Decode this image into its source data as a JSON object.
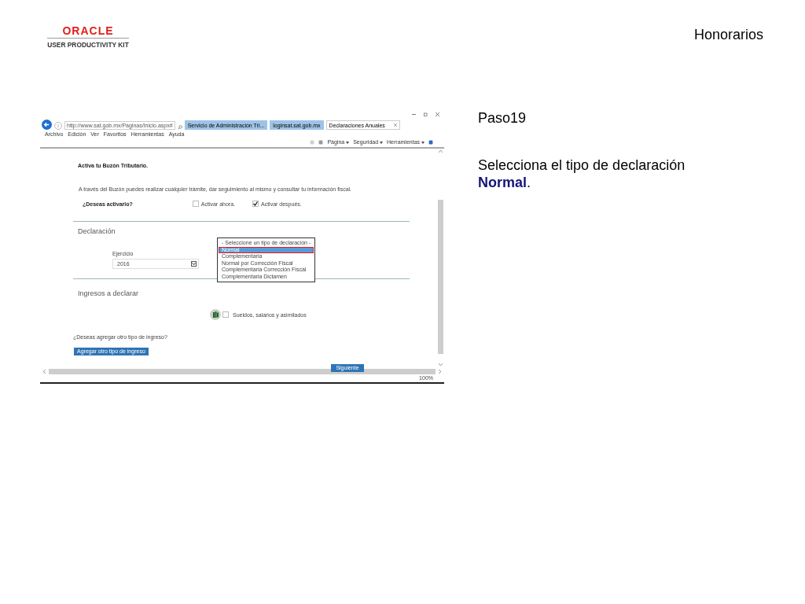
{
  "header": {
    "logo": {
      "brand": "ORACLE",
      "product": "USER PRODUCTIVITY KIT"
    },
    "title": "Honorarios"
  },
  "browser": {
    "address": "http://www.sat.gob.mx/Paginas/Inicio.aspx#",
    "tabs": [
      {
        "label": "Servicio de Administración Tri...",
        "selected": false
      },
      {
        "label": "loginsat.sat.gob.mx",
        "selected": false
      },
      {
        "label": "Declaraciones Anuales",
        "selected": true
      }
    ],
    "menu": [
      "Archivo",
      "Edición",
      "Ver",
      "Favoritos",
      "Herramientas",
      "Ayuda"
    ],
    "commands": [
      "Página",
      "Seguridad",
      "Herramientas"
    ],
    "zoom": "100%"
  },
  "page": {
    "buzon_title": "Activa tu Buzón Tributario.",
    "buzon_text": "A través del Buzón puedes realizar cualquier trámite, dar seguimiento al mismo y consultar tu información fiscal.",
    "question": "¿Deseas activarlo?",
    "options": [
      {
        "label": "Activar ahora.",
        "checked": false
      },
      {
        "label": "Activar después.",
        "checked": true
      }
    ],
    "declaracion_heading": "Declaración",
    "ejercicio_label": "Ejercicio",
    "ejercicio_value": "2016",
    "dropdown": [
      {
        "label": "- Seleccione un tipo de declaración -",
        "selected": false
      },
      {
        "label": "Normal",
        "selected": true
      },
      {
        "label": "Complementaria",
        "selected": false
      },
      {
        "label": "Normal por Corrección Fiscal",
        "selected": false
      },
      {
        "label": "Complementaria Corrección Fiscal",
        "selected": false
      },
      {
        "label": "Complementaria Dictamen",
        "selected": false
      }
    ],
    "ingresos_heading": "Ingresos a declarar",
    "income": {
      "label": "Sueldos, salarios y asimilados",
      "checked": false
    },
    "add_question": "¿Deseas agregar otro tipo de ingreso?",
    "add_button": "Agregar otro tipo de ingreso",
    "next_button": "Siguiente"
  },
  "instructions": {
    "step": "Paso19",
    "text": "Selecciona el tipo de declaración **Normal**."
  }
}
